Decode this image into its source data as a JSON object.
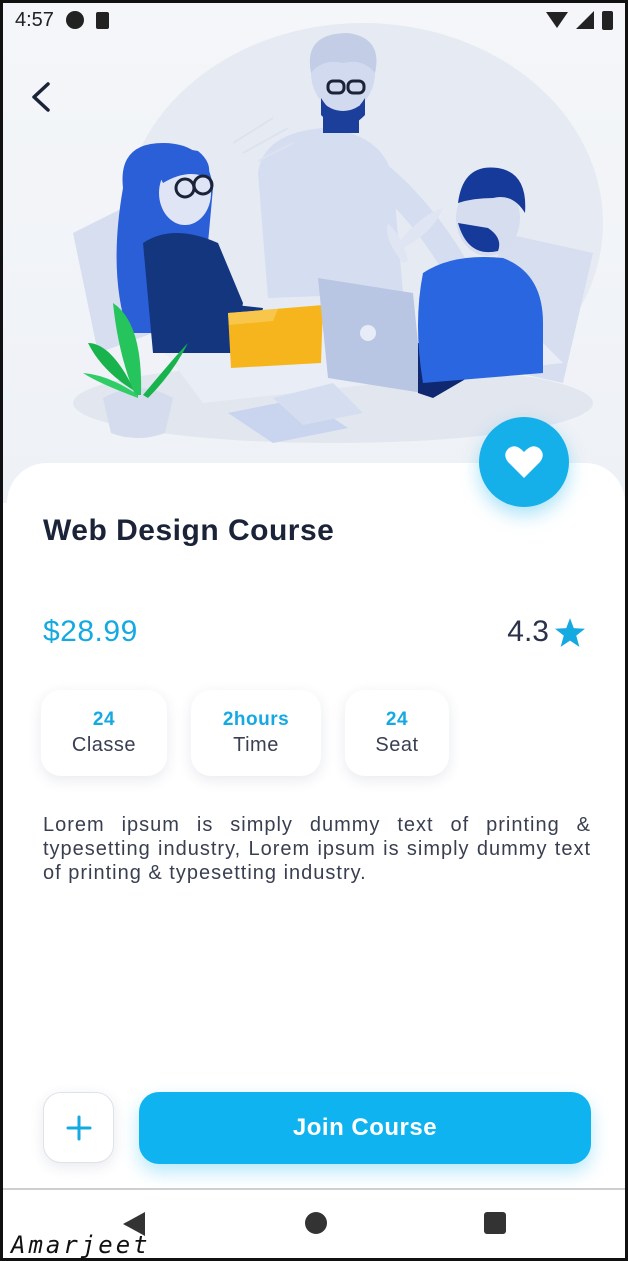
{
  "status_bar": {
    "time": "4:57",
    "icons_left": [
      "pause-circle-icon",
      "sd-card-icon"
    ],
    "icons_right": [
      "wifi-icon",
      "signal-icon",
      "battery-icon"
    ]
  },
  "header": {
    "back_icon": "chevron-left-icon"
  },
  "hero": {
    "illustration": "team-meeting-illustration"
  },
  "favorite": {
    "icon": "heart-icon",
    "color": "#15b0ea"
  },
  "course": {
    "title": "Web Design Course",
    "price": "$28.99",
    "rating": "4.3",
    "rating_icon": "star-icon",
    "description": "Lorem ipsum is simply dummy text of printing & typesetting industry, Lorem ipsum is simply dummy text of printing & typesetting industry."
  },
  "stats": [
    {
      "value": "24",
      "label": "Classe"
    },
    {
      "value": "2hours",
      "label": "Time"
    },
    {
      "value": "24",
      "label": "Seat"
    }
  ],
  "actions": {
    "add_icon": "plus-icon",
    "join_label": "Join Course"
  },
  "nav": {
    "icons": [
      "back-triangle-icon",
      "home-circle-icon",
      "recents-square-icon"
    ]
  },
  "watermark": "Amarjeet",
  "colors": {
    "accent": "#15b0ea",
    "title": "#1b2338",
    "price": "#15a9e2"
  }
}
